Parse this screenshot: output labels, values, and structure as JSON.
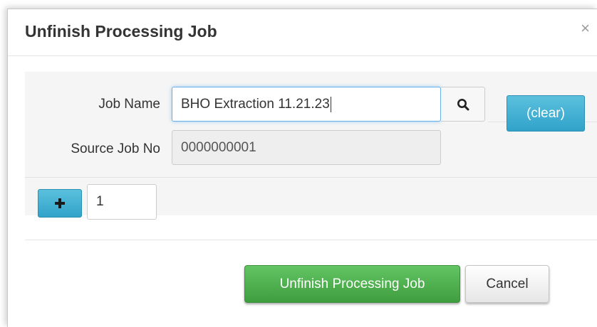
{
  "dialog": {
    "title": "Unfinish Processing Job",
    "close_label": "×"
  },
  "form": {
    "job_name_label": "Job Name",
    "job_name_value": "BHO Extraction 11.21.23",
    "search_icon": "search-icon",
    "clear_label": "(clear)",
    "source_job_label": "Source Job No",
    "source_job_value": "0000000001",
    "add_icon": "plus-icon",
    "count_value": "1"
  },
  "footer": {
    "primary_label": "Unfinish Processing Job",
    "cancel_label": "Cancel"
  },
  "colors": {
    "info": "#5bc0de",
    "success": "#5cb85c",
    "panel_bg": "#f5f5f5"
  }
}
